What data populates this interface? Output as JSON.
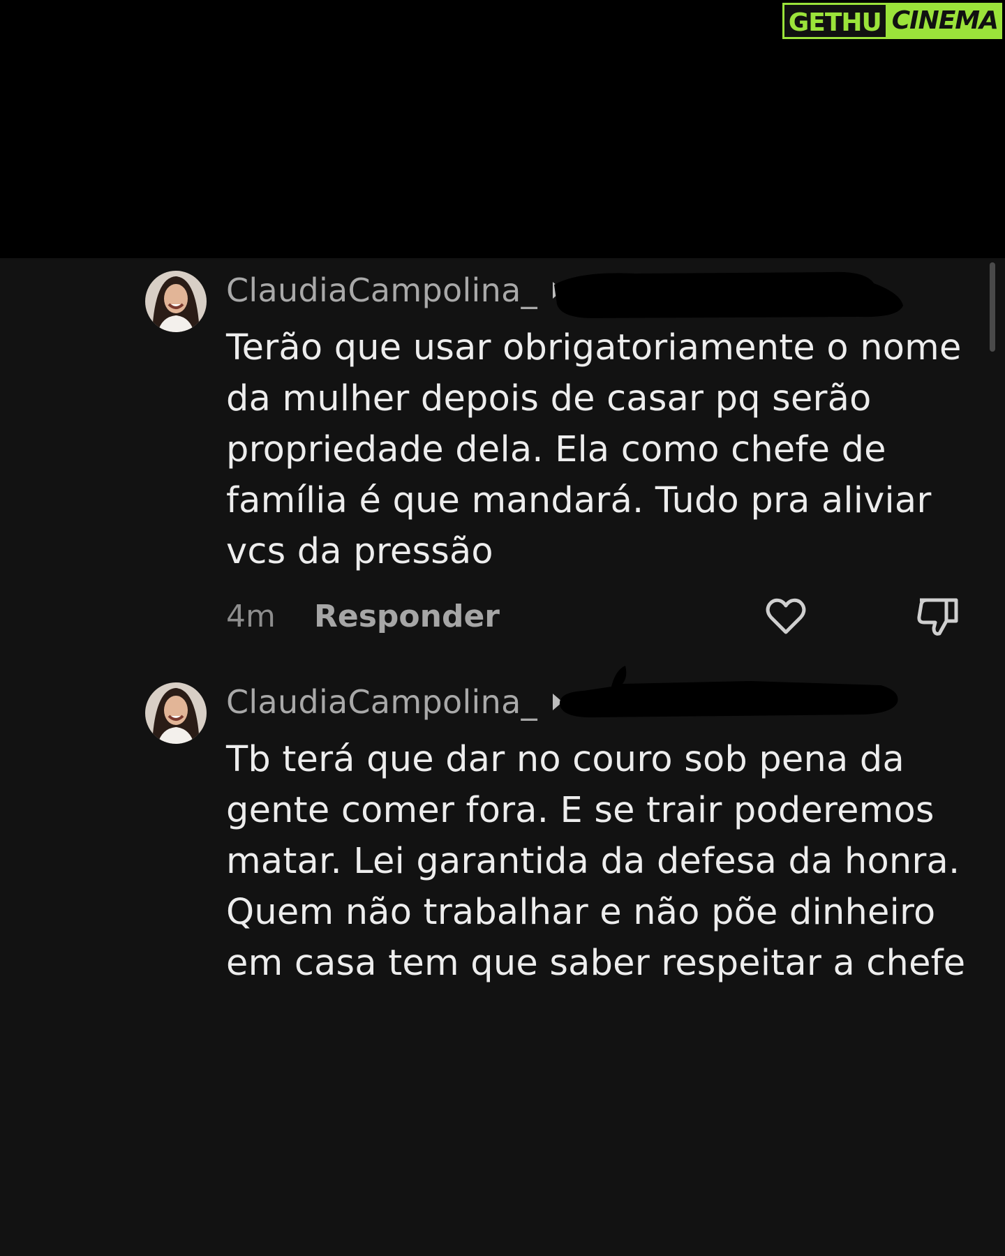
{
  "watermark": {
    "part1": "GETHU",
    "part2": "CINEMA"
  },
  "comments": [
    {
      "username": "ClaudiaCampolina_",
      "text": "Terão que usar obrigatoriamente o nome\nda mulher depois de casar pq serão\npropriedade dela. Ela como chefe de\nfamília é que mandará. Tudo pra aliviar\nvcs da pressão",
      "time": "4m",
      "reply_label": "Responder",
      "icons": [
        "heart-icon",
        "thumbs-down-icon"
      ]
    },
    {
      "username": "ClaudiaCampolina_",
      "text": "Tb terá que dar no couro sob pena da\ngente comer fora. E se trair poderemos\nmatar. Lei garantida da defesa da honra.\nQuem não trabalhar e não põe dinheiro\nem casa tem que saber respeitar a chefe"
    }
  ],
  "colors": {
    "background": "#121212",
    "top_background": "#000000",
    "username": "#a9a9a9",
    "text": "#ededed",
    "watermark_accent": "#9be33a"
  }
}
